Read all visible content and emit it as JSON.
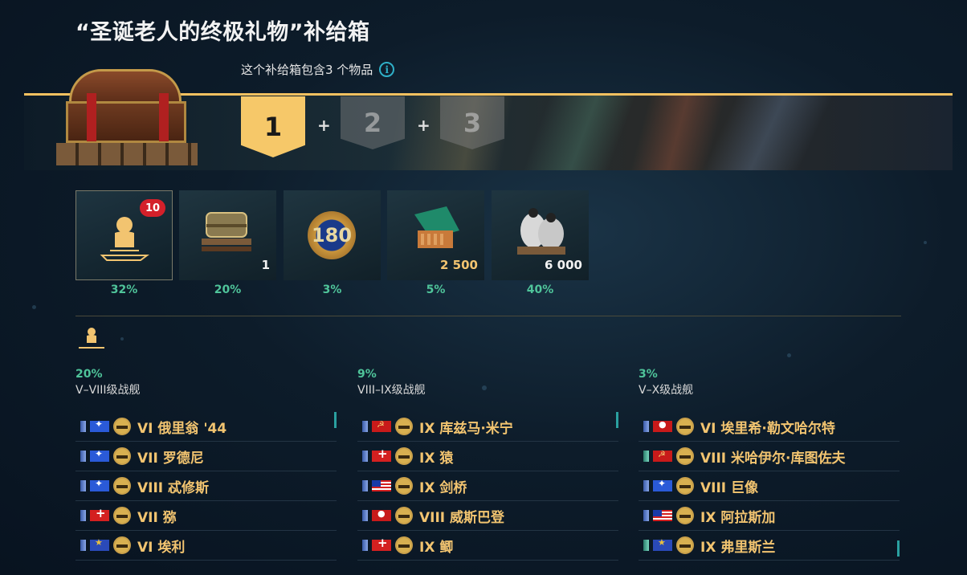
{
  "header": {
    "title": "“圣诞老人的终极礼物”补给箱",
    "subtitle": "这个补给箱包含3 个物品",
    "info_icon": "i"
  },
  "slots": [
    {
      "label": "1",
      "active": true
    },
    {
      "label": "2",
      "active": false
    },
    {
      "label": "3",
      "active": false
    }
  ],
  "plus_sign": "+",
  "rewards": [
    {
      "icon": "ship-silhouette-icon",
      "badge": "10",
      "quantity": "",
      "chance": "32%",
      "selected": true
    },
    {
      "icon": "container-chest-icon",
      "badge": "",
      "quantity": "1",
      "chance": "20%",
      "selected": false
    },
    {
      "icon": "emblem-180-icon",
      "badge": "",
      "quantity": "",
      "chance": "3%",
      "selected": false,
      "emblem_text": "180"
    },
    {
      "icon": "signal-flags-icon",
      "badge": "",
      "quantity": "2 500",
      "chance": "5%",
      "selected": false
    },
    {
      "icon": "coal-sacks-icon",
      "badge": "",
      "quantity": "6 000",
      "chance": "40%",
      "selected": false
    }
  ],
  "columns": [
    {
      "chance": "20%",
      "label": "V–VIII级战舰",
      "ships": [
        {
          "name": "VI 俄里翁 '44",
          "flag": "uk",
          "nation_color": "blue"
        },
        {
          "name": "VII 罗德尼",
          "flag": "uk",
          "nation_color": "blue"
        },
        {
          "name": "VIII 忒修斯",
          "flag": "uk",
          "nation_color": "blue"
        },
        {
          "name": "VII 猕",
          "flag": "eu",
          "nation_color": "blue"
        },
        {
          "name": "VI 埃利",
          "flag": "pan",
          "nation_color": "blue"
        }
      ]
    },
    {
      "chance": "9%",
      "label": "VIII–IX级战舰",
      "ships": [
        {
          "name": "IX 库兹马·米宁",
          "flag": "com",
          "nation_color": "blue"
        },
        {
          "name": "IX 猿",
          "flag": "eu",
          "nation_color": "blue"
        },
        {
          "name": "IX 剑桥",
          "flag": "pa",
          "nation_color": "blue"
        },
        {
          "name": "VIII 威斯巴登",
          "flag": "ger",
          "nation_color": "blue"
        },
        {
          "name": "IX 鲫",
          "flag": "eu",
          "nation_color": "blue"
        }
      ]
    },
    {
      "chance": "3%",
      "label": "V–X级战舰",
      "ships": [
        {
          "name": "VI 埃里希·勒文哈尔特",
          "flag": "ger",
          "nation_color": "blue"
        },
        {
          "name": "VIII 米哈伊尔·库图佐夫",
          "flag": "com",
          "nation_color": "green"
        },
        {
          "name": "VIII 巨像",
          "flag": "uk",
          "nation_color": "blue"
        },
        {
          "name": "IX 阿拉斯加",
          "flag": "pa",
          "nation_color": "blue"
        },
        {
          "name": "IX 弗里斯兰",
          "flag": "pan",
          "nation_color": "green"
        }
      ]
    }
  ],
  "colors": {
    "accent_gold": "#f6c869",
    "percent_green": "#4fc49a",
    "ship_name_gold": "#f2c470",
    "badge_red": "#d4202a"
  }
}
